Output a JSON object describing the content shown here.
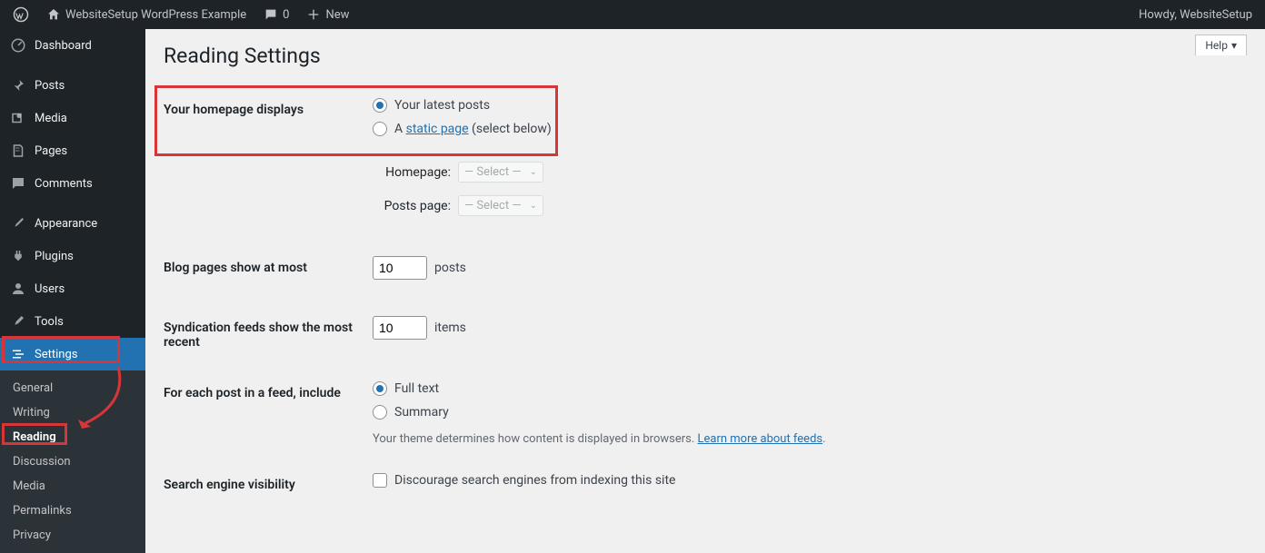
{
  "toolbar": {
    "site_title": "WebsiteSetup WordPress Example",
    "comments_count": "0",
    "new_label": "New",
    "howdy": "Howdy, WebsiteSetup"
  },
  "sidebar": {
    "items": [
      {
        "label": "Dashboard"
      },
      {
        "label": "Posts"
      },
      {
        "label": "Media"
      },
      {
        "label": "Pages"
      },
      {
        "label": "Comments"
      },
      {
        "label": "Appearance"
      },
      {
        "label": "Plugins"
      },
      {
        "label": "Users"
      },
      {
        "label": "Tools"
      },
      {
        "label": "Settings"
      }
    ],
    "submenu": [
      {
        "label": "General"
      },
      {
        "label": "Writing"
      },
      {
        "label": "Reading"
      },
      {
        "label": "Discussion"
      },
      {
        "label": "Media"
      },
      {
        "label": "Permalinks"
      },
      {
        "label": "Privacy"
      }
    ]
  },
  "page": {
    "title": "Reading Settings",
    "help": "Help"
  },
  "form": {
    "homepage_displays": {
      "label": "Your homepage displays",
      "opt1": "Your latest posts",
      "opt2_prefix": "A ",
      "opt2_link": "static page",
      "opt2_suffix": " (select below)",
      "homepage_label": "Homepage:",
      "posts_page_label": "Posts page:",
      "select_placeholder": "— Select —"
    },
    "blog_pages": {
      "label": "Blog pages show at most",
      "value": "10",
      "unit": "posts"
    },
    "syndication": {
      "label": "Syndication feeds show the most recent",
      "value": "10",
      "unit": "items"
    },
    "feed_content": {
      "label": "For each post in a feed, include",
      "opt1": "Full text",
      "opt2": "Summary",
      "desc_prefix": "Your theme determines how content is displayed in browsers. ",
      "desc_link": "Learn more about feeds"
    },
    "search_engine": {
      "label": "Search engine visibility",
      "checkbox_label": "Discourage search engines from indexing this site"
    }
  }
}
